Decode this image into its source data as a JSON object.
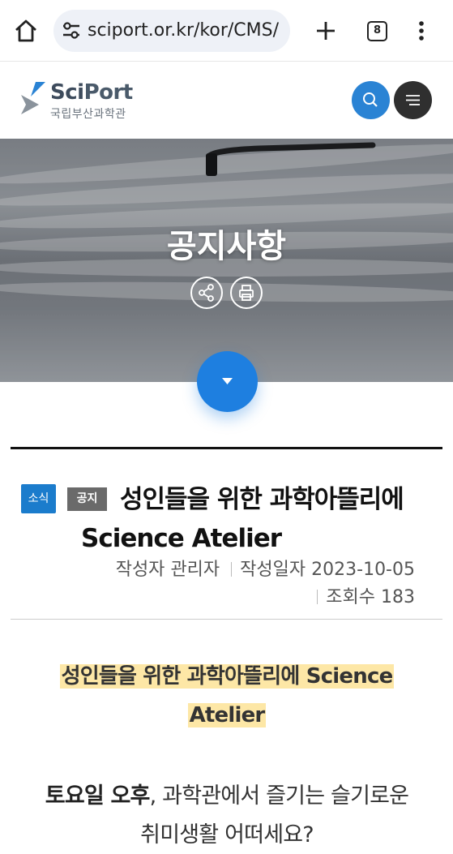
{
  "browser": {
    "url": "sciport.or.kr/kor/CMS/",
    "tab_count": "8"
  },
  "site": {
    "logo_en_sci": "Sci",
    "logo_en_port": "Port",
    "logo_ko": "국립부산과학관",
    "accent_color": "#2a83d4"
  },
  "hero": {
    "title": "공지사항"
  },
  "post": {
    "category_badge": "소식",
    "type_badge": "공지",
    "title": "성인들을 위한 과학아뜰리에 Science Atelier",
    "author_label": "작성자",
    "author": "관리자",
    "date_label": "작성일자",
    "date": "2023-10-05",
    "views_label": "조회수",
    "views": "183"
  },
  "content": {
    "headline_line1": "성인들을 위한 과학아뜰리에 Science",
    "headline_line2": "Atelier",
    "intro_bold": "토요일 오후",
    "intro_rest_1": ", 과학관에서 즐기는 슬기로운",
    "intro_line2": "취미생활 어떠세요?"
  }
}
